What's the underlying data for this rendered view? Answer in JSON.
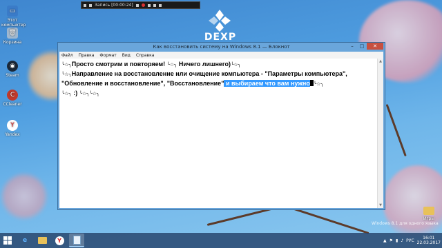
{
  "recording_toolbar": {
    "label": "Запись [00:00:24]"
  },
  "wallpaper": {
    "brand": "DEXP"
  },
  "desktop_icons": [
    {
      "label": "Этот компьютер",
      "icon": "computer-icon"
    },
    {
      "label": "Корзина",
      "icon": "recycle-bin-icon"
    },
    {
      "label": "Steam",
      "icon": "steam-icon"
    },
    {
      "label": "CCleaner",
      "icon": "ccleaner-icon"
    },
    {
      "label": "Yandex",
      "icon": "yandex-icon"
    },
    {
      "label": "Игры",
      "icon": "folder-icon"
    }
  ],
  "window": {
    "title": "Как восстановить систему на Windows 8.1 — Блокнот",
    "menu": [
      "Файл",
      "Правка",
      "Формат",
      "Вид",
      "Справка"
    ],
    "content": {
      "line1_a": "Просто смотрим и повторяем! ",
      "line1_b": " Ничего лишнего)",
      "line2": "Направление на восстановление или очищение компьютера - \"Параметры компьютера\",",
      "line3_a": "\"Обновление и восстановление\", \"Восстановление\"",
      "line3_selected": " и выбираем что вам нужно",
      "line4": " :) ",
      "emoticon": "╰☆╮"
    }
  },
  "watermark": "Windows 8.1 для одного языка",
  "taskbar": {
    "items": [
      {
        "name": "internet-explorer",
        "icon": "ie-icon"
      },
      {
        "name": "file-explorer",
        "icon": "folder-icon"
      },
      {
        "name": "yandex-browser",
        "icon": "yandex-icon"
      },
      {
        "name": "notepad",
        "icon": "notepad-icon"
      }
    ],
    "language": "РУС",
    "time": "16:01",
    "date": "22.03.2017"
  },
  "colors": {
    "selection": "#3399ff",
    "close_button": "#c7503f",
    "window_frame": "#6aa6db"
  }
}
